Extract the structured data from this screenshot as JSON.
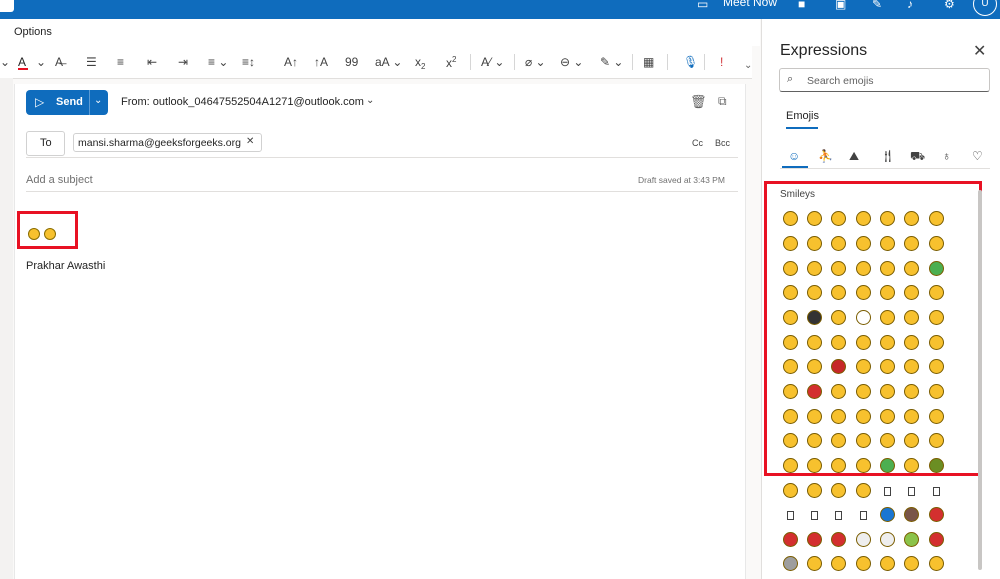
{
  "topbar": {
    "meet_now": "Meet Now",
    "avatar": "U"
  },
  "menu": {
    "options": "Options"
  },
  "ribbon": {
    "items": [
      {
        "icon": "font-color-icon",
        "glyph": "A"
      },
      {
        "icon": "dropdown-chevron-icon",
        "glyph": "⌄"
      },
      {
        "icon": "clear-format-icon",
        "glyph": "A̶"
      },
      {
        "icon": "bullets-icon",
        "glyph": "☰"
      },
      {
        "icon": "numbering-icon",
        "glyph": "≡"
      },
      {
        "icon": "decrease-indent-icon",
        "glyph": "⇤"
      },
      {
        "icon": "increase-indent-icon",
        "glyph": "⇥"
      },
      {
        "icon": "align-icon",
        "glyph": "≡"
      },
      {
        "icon": "line-spacing-icon",
        "glyph": "↕"
      },
      {
        "icon": "para-spacing-icon",
        "glyph": "A↑"
      },
      {
        "icon": "para-spacing-2-icon",
        "glyph": "↑A"
      },
      {
        "icon": "quote-icon",
        "glyph": "99"
      },
      {
        "icon": "font-size-icon",
        "glyph": "aA"
      },
      {
        "icon": "subscript-icon",
        "glyph": "x"
      },
      {
        "icon": "superscript-icon",
        "glyph": "x"
      },
      {
        "icon": "styles-icon",
        "glyph": "A⁄"
      },
      {
        "icon": "attach-icon",
        "glyph": "⌀"
      },
      {
        "icon": "link-icon",
        "glyph": "⊖"
      },
      {
        "icon": "signature-icon",
        "glyph": "✎"
      },
      {
        "icon": "table-icon",
        "glyph": "▦"
      },
      {
        "icon": "dictate-icon",
        "glyph": "●"
      },
      {
        "icon": "sensitivity-icon",
        "glyph": "!"
      }
    ]
  },
  "compose": {
    "send_label": "Send",
    "from": "From: outlook_04647552504A1271@outlook.com",
    "to_label": "To",
    "recipient": "mansi.sharma@geeksforgeeks.org",
    "cc": "Cc",
    "bcc": "Bcc",
    "subject_placeholder": "Add a subject",
    "draft_status": "Draft saved at 3:43 PM",
    "signature": "Prakhar Awasthi"
  },
  "expressions": {
    "title": "Expressions",
    "search_placeholder": "Search emojis",
    "tab": "Emojis",
    "section": "Smileys",
    "categories": [
      "smiley-icon",
      "person-icon",
      "activity-icon",
      "food-icon",
      "travel-icon",
      "objects-icon",
      "heart-icon"
    ]
  },
  "colors": {
    "accent": "#0f6cbd",
    "highlight": "#e81123",
    "emoji_yellow": "#f7c12e"
  }
}
